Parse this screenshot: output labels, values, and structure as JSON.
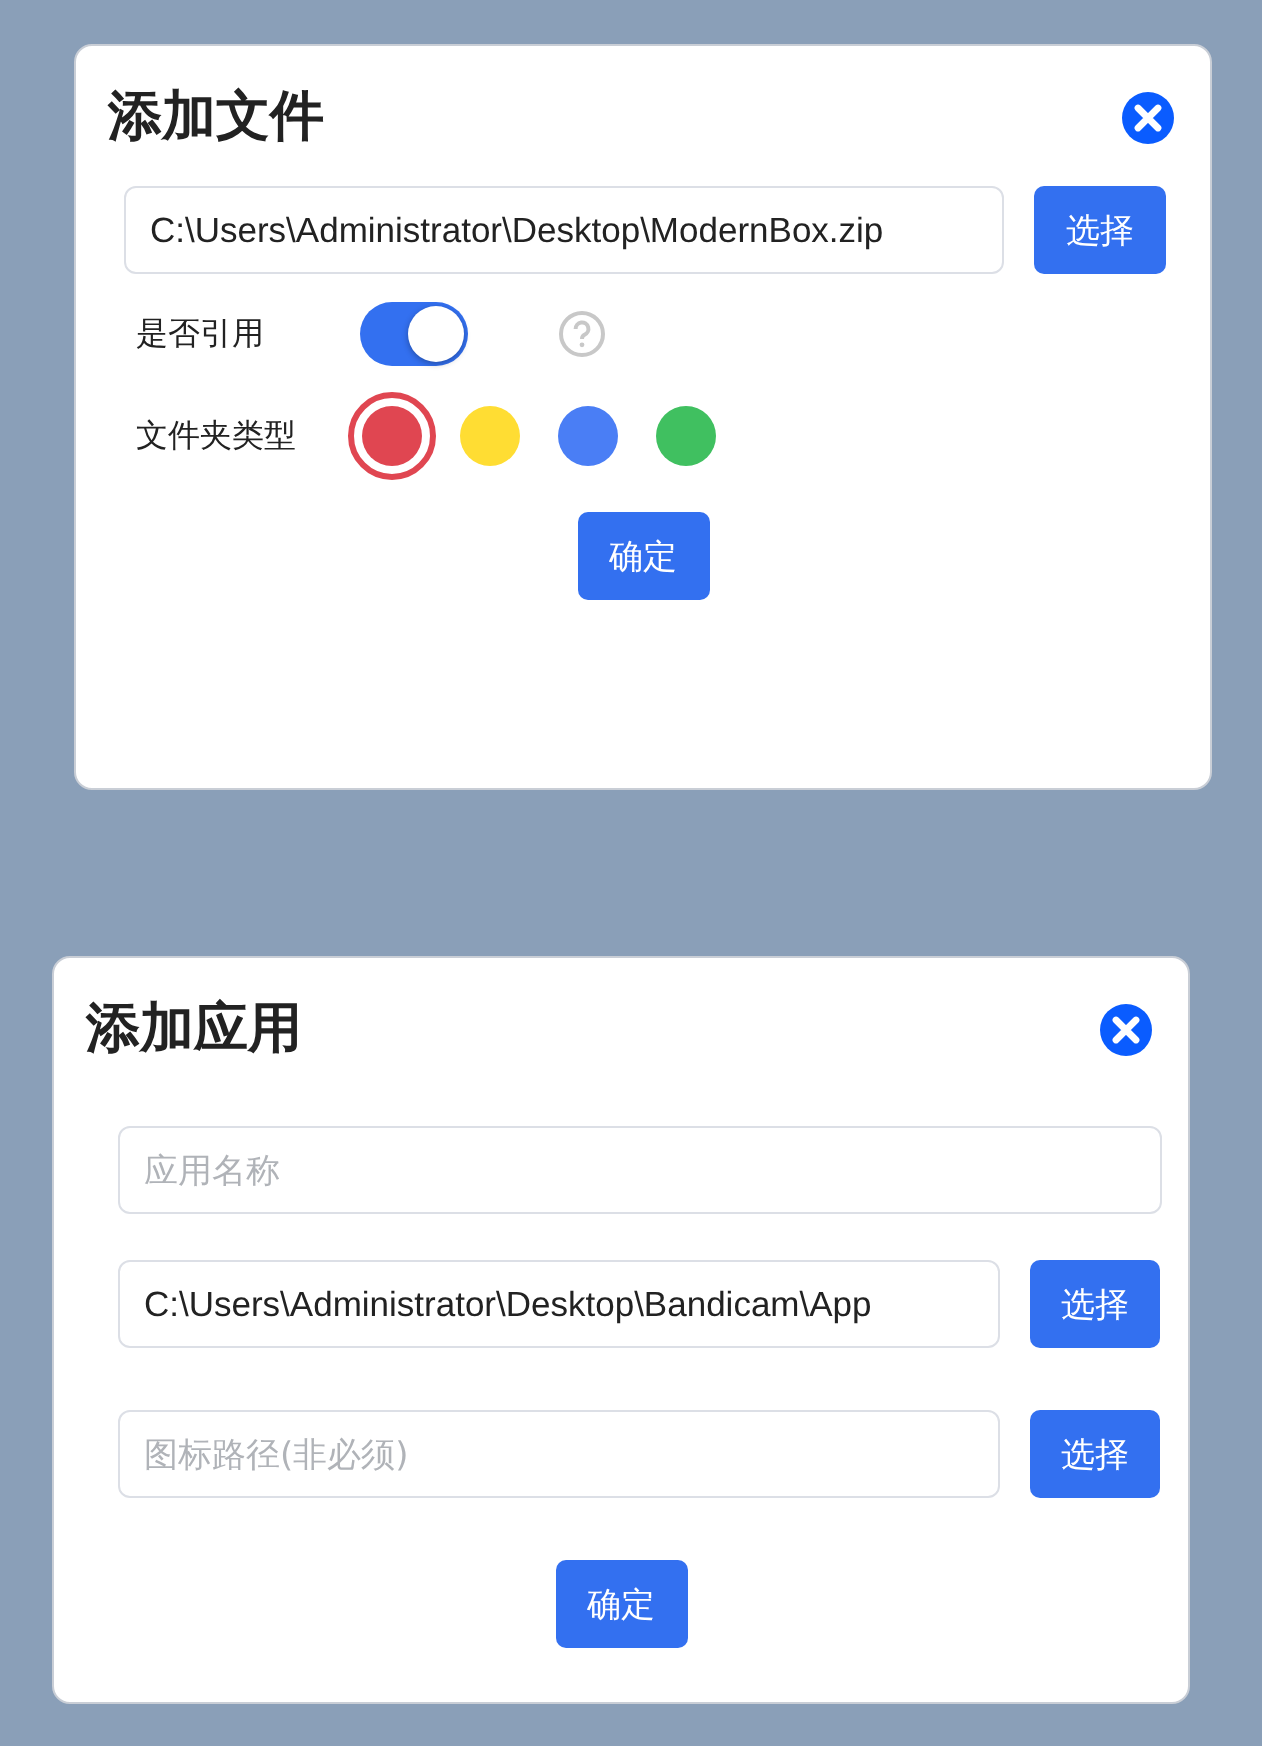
{
  "file_dialog": {
    "title": "添加文件",
    "path_field": {
      "value": "C:\\Users\\Administrator\\Desktop\\ModernBox.zip"
    },
    "choose_button": "选择",
    "reference": {
      "label": "是否引用",
      "on": true
    },
    "folder_type": {
      "label": "文件夹类型",
      "options": [
        {
          "color": "#e04651",
          "selected": true
        },
        {
          "color": "#ffdd33",
          "selected": false
        },
        {
          "color": "#4a7ef5",
          "selected": false
        },
        {
          "color": "#40c060",
          "selected": false
        }
      ]
    },
    "confirm_button": "确定"
  },
  "app_dialog": {
    "title": "添加应用",
    "name_field": {
      "placeholder": "应用名称"
    },
    "path_field": {
      "value": "C:\\Users\\Administrator\\Desktop\\Bandicam\\App"
    },
    "path_button": "选择",
    "icon_field": {
      "placeholder": "图标路径(非必须)"
    },
    "icon_button": "选择",
    "confirm_button": "确定"
  }
}
